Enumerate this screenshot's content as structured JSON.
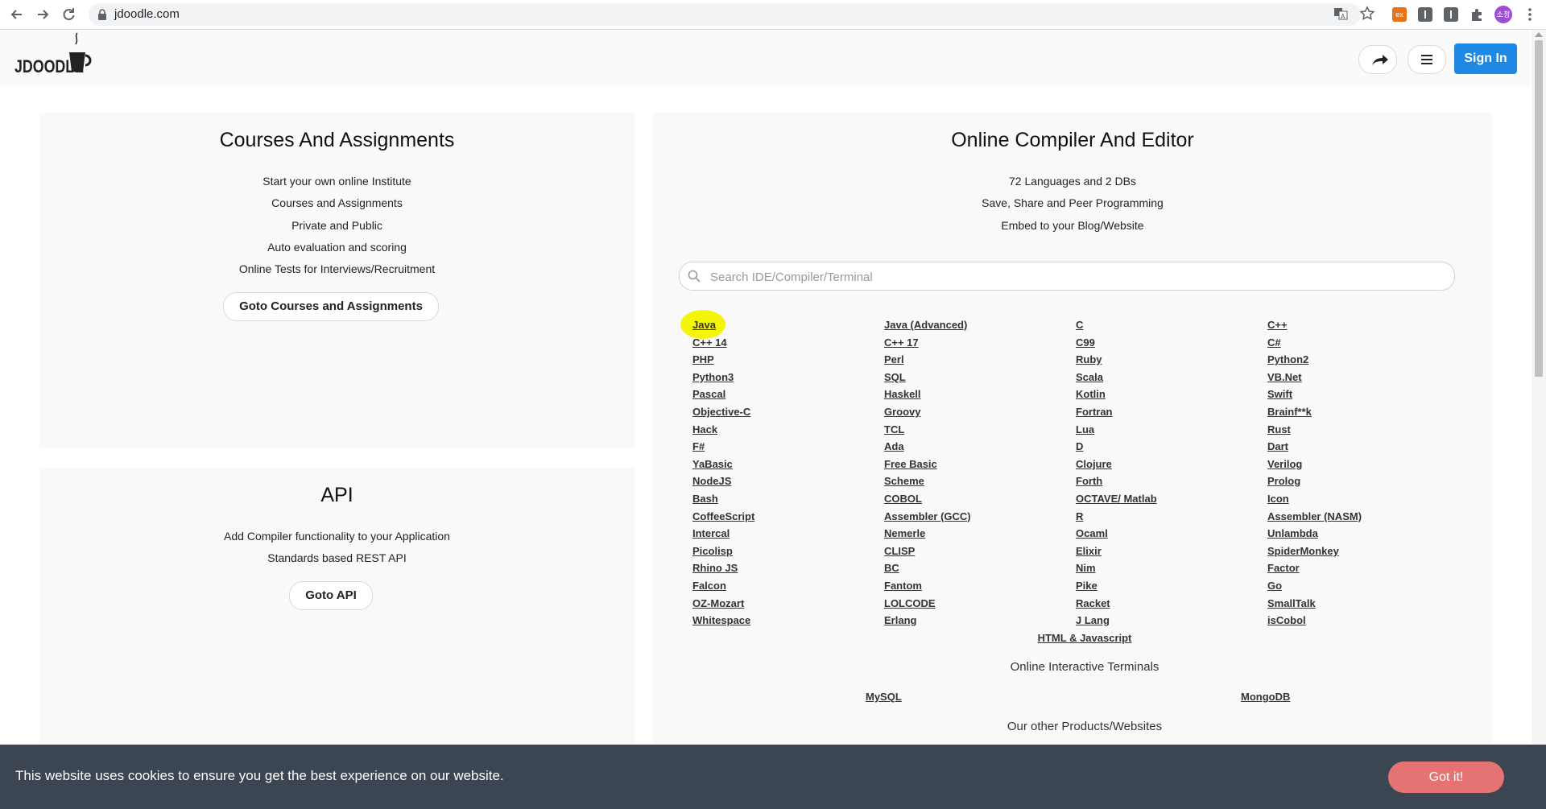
{
  "browser": {
    "url": "jdoodle.com",
    "avatar_text": "소정",
    "extension_badge": "ex"
  },
  "header": {
    "logo_text": "JDOODLE",
    "sign_in_label": "Sign In"
  },
  "courses_card": {
    "title": "Courses And Assignments",
    "lines": [
      "Start your own online Institute",
      "Courses and Assignments",
      "Private and Public",
      "Auto evaluation and scoring",
      "Online Tests for Interviews/Recruitment"
    ],
    "button_label": "Goto Courses and Assignments"
  },
  "api_card": {
    "title": "API",
    "lines": [
      "Add Compiler functionality to your Application",
      "Standards based REST API"
    ],
    "button_label": "Goto API"
  },
  "compiler_card": {
    "title": "Online Compiler And Editor",
    "lines": [
      "72 Languages and 2 DBs",
      "Save, Share and Peer Programming",
      "Embed to your Blog/Website"
    ],
    "search_placeholder": "Search IDE/Compiler/Terminal",
    "languages": [
      "Java",
      "Java (Advanced)",
      "C",
      "C++",
      "C++ 14",
      "C++ 17",
      "C99",
      "C#",
      "PHP",
      "Perl",
      "Ruby",
      "Python2",
      "Python3",
      "SQL",
      "Scala",
      "VB.Net",
      "Pascal",
      "Haskell",
      "Kotlin",
      "Swift",
      "Objective-C",
      "Groovy",
      "Fortran",
      "Brainf**k",
      "Hack",
      "TCL",
      "Lua",
      "Rust",
      "F#",
      "Ada",
      "D",
      "Dart",
      "YaBasic",
      "Free Basic",
      "Clojure",
      "Verilog",
      "NodeJS",
      "Scheme",
      "Forth",
      "Prolog",
      "Bash",
      "COBOL",
      "OCTAVE/ Matlab",
      "Icon",
      "CoffeeScript",
      "Assembler (GCC)",
      "R",
      "Assembler (NASM)",
      "Intercal",
      "Nemerle",
      "Ocaml",
      "Unlambda",
      "Picolisp",
      "CLISP",
      "Elixir",
      "SpiderMonkey",
      "Rhino JS",
      "BC",
      "Nim",
      "Factor",
      "Falcon",
      "Fantom",
      "Pike",
      "Go",
      "OZ-Mozart",
      "LOLCODE",
      "Racket",
      "SmallTalk",
      "Whitespace",
      "Erlang",
      "J Lang",
      "isCobol"
    ],
    "html_js_link": "HTML & Javascript",
    "terminals_heading": "Online Interactive Terminals",
    "terminals": [
      "MySQL",
      "MongoDB"
    ],
    "other_heading": "Our other Products/Websites"
  },
  "cookie": {
    "text": "This website uses cookies to ensure you get the best experience on our website.",
    "button_label": "Got it!"
  },
  "colors": {
    "primary": "#1e88e5",
    "cookie_bg": "#3c4552",
    "cookie_button": "#e57373",
    "highlight": "#f5f50a"
  }
}
